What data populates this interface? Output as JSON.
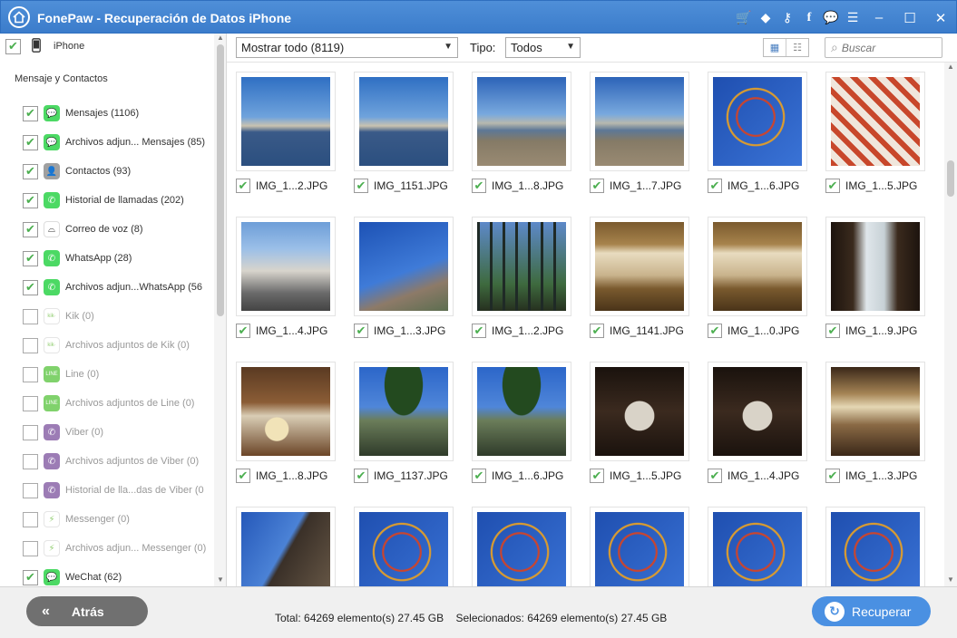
{
  "titlebar": {
    "title": "FonePaw - Recuperación de Datos iPhone",
    "icons": [
      "home-icon",
      "cart-icon",
      "diamond-icon",
      "key-icon",
      "facebook-icon",
      "chat-icon",
      "feedback-icon"
    ],
    "window_controls": [
      "minimize",
      "maximize",
      "close"
    ],
    "glyphs": {
      "cart": "🛒",
      "diamond": "◆",
      "key": "⚷",
      "facebook": "f",
      "chat": "💬",
      "feedback": "☰",
      "minimize": "–",
      "maximize": "☐",
      "close": "✕"
    }
  },
  "sidebar": {
    "device": {
      "label": "iPhone",
      "checked": true
    },
    "section_title": "Mensaje y Contactos",
    "items": [
      {
        "label": "Mensajes (1106)",
        "checked": true,
        "enabled": true,
        "icon": "messages-icon",
        "color": "#4cd964",
        "glyph": "💬"
      },
      {
        "label": "Archivos adjun... Mensajes (85)",
        "checked": true,
        "enabled": true,
        "icon": "message-attachments-icon",
        "color": "#4cd964",
        "glyph": "💬"
      },
      {
        "label": "Contactos (93)",
        "checked": true,
        "enabled": true,
        "icon": "contacts-icon",
        "color": "#a0a0a0",
        "glyph": "👤"
      },
      {
        "label": "Historial de llamadas (202)",
        "checked": true,
        "enabled": true,
        "icon": "phone-icon",
        "color": "#4cd964",
        "glyph": "✆"
      },
      {
        "label": "Correo de voz (8)",
        "checked": true,
        "enabled": true,
        "icon": "voicemail-icon",
        "color": "#ffffff",
        "glyph": "⌓"
      },
      {
        "label": "WhatsApp (28)",
        "checked": true,
        "enabled": true,
        "icon": "whatsapp-icon",
        "color": "#4cd964",
        "glyph": "✆"
      },
      {
        "label": "Archivos adjun...WhatsApp (56",
        "checked": true,
        "enabled": true,
        "icon": "whatsapp-attachments-icon",
        "color": "#4cd964",
        "glyph": "✆"
      },
      {
        "label": "Kik (0)",
        "checked": false,
        "enabled": false,
        "icon": "kik-icon",
        "color": "#ffffff",
        "glyph": "kik·"
      },
      {
        "label": "Archivos adjuntos de Kik (0)",
        "checked": false,
        "enabled": false,
        "icon": "kik-attachments-icon",
        "color": "#ffffff",
        "glyph": "kik·"
      },
      {
        "label": "Line (0)",
        "checked": false,
        "enabled": false,
        "icon": "line-icon",
        "color": "#56c33b",
        "glyph": "LINE"
      },
      {
        "label": "Archivos adjuntos de Line (0)",
        "checked": false,
        "enabled": false,
        "icon": "line-attachments-icon",
        "color": "#56c33b",
        "glyph": "LINE"
      },
      {
        "label": "Viber (0)",
        "checked": false,
        "enabled": false,
        "icon": "viber-icon",
        "color": "#7b519d",
        "glyph": "✆"
      },
      {
        "label": "Archivos adjuntos de Viber (0)",
        "checked": false,
        "enabled": false,
        "icon": "viber-attachments-icon",
        "color": "#7b519d",
        "glyph": "✆"
      },
      {
        "label": "Historial de lla...das de Viber (0",
        "checked": false,
        "enabled": false,
        "icon": "viber-calls-icon",
        "color": "#7b519d",
        "glyph": "✆"
      },
      {
        "label": "Messenger (0)",
        "checked": false,
        "enabled": false,
        "icon": "messenger-icon",
        "color": "#ffffff",
        "glyph": "⚡"
      },
      {
        "label": "Archivos adjun... Messenger (0)",
        "checked": false,
        "enabled": false,
        "icon": "messenger-attachments-icon",
        "color": "#ffffff",
        "glyph": "⚡"
      },
      {
        "label": "WeChat (62)",
        "checked": true,
        "enabled": true,
        "icon": "wechat-icon",
        "color": "#4cd964",
        "glyph": "💬"
      }
    ]
  },
  "toolbar": {
    "filter_value": "Mostrar todo (8119)",
    "type_label": "Tipo:",
    "type_value": "Todos",
    "search_placeholder": "Buscar",
    "search_glyph": "⌕",
    "view_glyphs": {
      "grid": "▦",
      "list": "☷"
    }
  },
  "photos": [
    {
      "name": "IMG_1...2.JPG",
      "checked": true,
      "scene": "harbor"
    },
    {
      "name": "IMG_1151.JPG",
      "checked": true,
      "scene": "harbor"
    },
    {
      "name": "IMG_1...8.JPG",
      "checked": true,
      "scene": "harbor-wall"
    },
    {
      "name": "IMG_1...7.JPG",
      "checked": true,
      "scene": "harbor-wall"
    },
    {
      "name": "IMG_1...6.JPG",
      "checked": true,
      "scene": "ferris-wheel"
    },
    {
      "name": "IMG_1...5.JPG",
      "checked": true,
      "scene": "ferris-closeup"
    },
    {
      "name": "IMG_1...4.JPG",
      "checked": true,
      "scene": "street"
    },
    {
      "name": "IMG_1...3.JPG",
      "checked": true,
      "scene": "house-sky"
    },
    {
      "name": "IMG_1...2.JPG",
      "checked": true,
      "scene": "gate"
    },
    {
      "name": "IMG_1141.JPG",
      "checked": true,
      "scene": "booth"
    },
    {
      "name": "IMG_1...0.JPG",
      "checked": true,
      "scene": "booth"
    },
    {
      "name": "IMG_1...9.JPG",
      "checked": true,
      "scene": "dark-window"
    },
    {
      "name": "IMG_1...8.JPG",
      "checked": true,
      "scene": "interior-flowers"
    },
    {
      "name": "IMG_1137.JPG",
      "checked": true,
      "scene": "tree-house"
    },
    {
      "name": "IMG_1...6.JPG",
      "checked": true,
      "scene": "tree-house"
    },
    {
      "name": "IMG_1...5.JPG",
      "checked": true,
      "scene": "dining"
    },
    {
      "name": "IMG_1...4.JPG",
      "checked": true,
      "scene": "dining"
    },
    {
      "name": "IMG_1...3.JPG",
      "checked": true,
      "scene": "lounge"
    },
    {
      "name": "",
      "checked": true,
      "scene": "tower"
    },
    {
      "name": "",
      "checked": true,
      "scene": "ferris-wheel"
    },
    {
      "name": "",
      "checked": true,
      "scene": "ferris-wheel"
    },
    {
      "name": "",
      "checked": true,
      "scene": "ferris-wheel"
    },
    {
      "name": "",
      "checked": true,
      "scene": "ferris-wheel"
    },
    {
      "name": "",
      "checked": true,
      "scene": "ferris-wheel"
    }
  ],
  "footer": {
    "back_label": "Atrás",
    "back_glyph": "«",
    "total": "Total: 64269 elemento(s) 27.45 GB",
    "selected": "Selecionados: 64269 elemento(s) 27.45 GB",
    "recover_label": "Recuperar",
    "recover_glyph": "↻"
  },
  "colors": {
    "titlebar": "#3b7ccb",
    "accent": "#4a90e2",
    "check": "#4caf50",
    "back_button": "#707070"
  }
}
